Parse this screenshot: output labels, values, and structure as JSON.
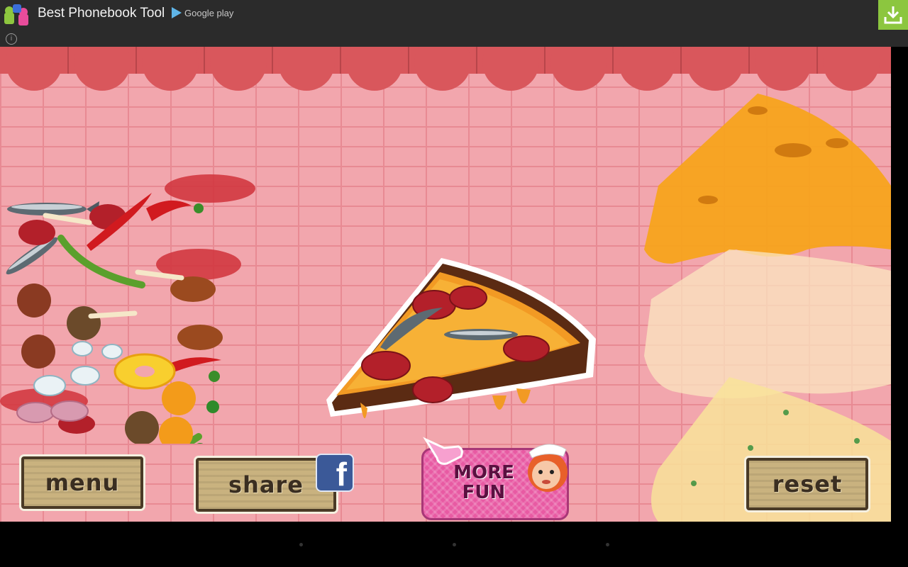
{
  "ad": {
    "app_name": "Best Phonebook Tool",
    "store_label": "Google play",
    "colors": {
      "background": "#2b2b2b",
      "download_bg": "#8cc63f"
    },
    "icons": [
      "info-icon",
      "download-icon",
      "app-icon"
    ]
  },
  "game": {
    "buttons": {
      "menu": "menu",
      "share": "share",
      "more_fun": "MORE FUN",
      "reset": "reset"
    },
    "icons": [
      "facebook-icon",
      "pointing-hand-icon",
      "chef-mascot-icon"
    ],
    "colors": {
      "brick": "#f2a6ad",
      "awning": "#d9575c",
      "wood": "#c9b27f",
      "more_fun": "#e85aa3"
    }
  },
  "toppings": [
    "anchovy",
    "pepperoni",
    "chili-pepper",
    "green-onion",
    "meatball",
    "sausage",
    "garlic",
    "pineapple-ring",
    "ham",
    "bacon",
    "tomato-sauce"
  ],
  "sauces": [
    "cheese-orange",
    "cheese-white",
    "cheese-yellow"
  ]
}
